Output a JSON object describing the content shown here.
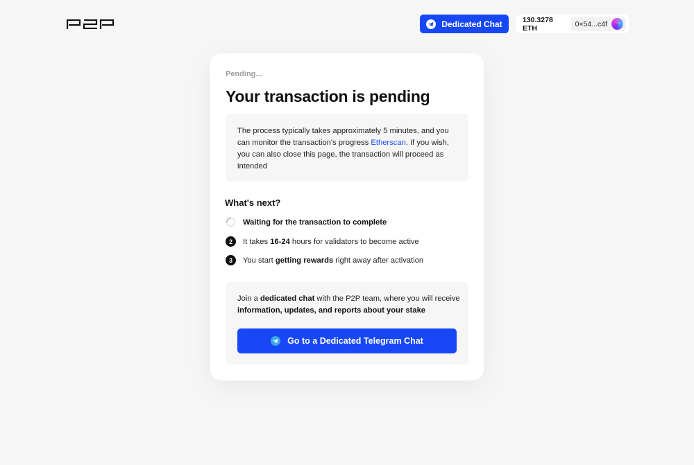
{
  "header": {
    "logo_text": "P2P",
    "chat_button_label": "Dedicated Chat",
    "balance": "130.3278 ETH",
    "address": "0×54...c4f"
  },
  "card": {
    "status": "Pending...",
    "title": "Your transaction is pending",
    "info": {
      "text_before_link": "The process typically takes approximately 5 minutes, and you can monitor the transaction's progress ",
      "link_label": "Etherscan",
      "text_after_link": ". If you wish, you can also close this page, the transaction will proceed as intended"
    },
    "next_title": "What's next?",
    "steps": [
      {
        "state": "loading",
        "label": "Waiting for the transaction to complete"
      },
      {
        "number": "2",
        "pre": "It takes ",
        "bold": "16-24",
        "post": " hours for validators to become active"
      },
      {
        "number": "3",
        "pre": "You start ",
        "bold": "getting rewards",
        "post": " right away after activation"
      }
    ],
    "join": {
      "t1": "Join a ",
      "b1": "dedicated chat",
      "t2": " with the P2P team, where you will receive ",
      "b2": "information, updates, and reports about your stake",
      "button_label": "Go to a Dedicated Telegram Chat"
    }
  },
  "colors": {
    "accent": "#1848f5",
    "background": "#f6f6f7"
  },
  "icons": {
    "chat_button": "telegram-icon",
    "step1": "spinner-icon",
    "join_button": "telegram-icon"
  }
}
